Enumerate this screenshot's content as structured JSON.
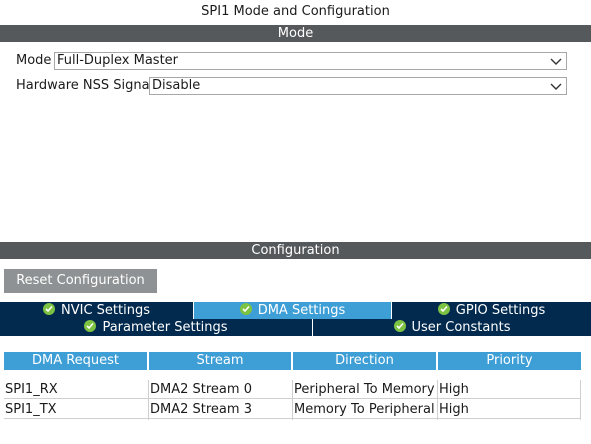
{
  "window": {
    "title": "SPI1 Mode and Configuration"
  },
  "mode_section": {
    "header": "Mode",
    "fields": [
      {
        "label": "Mode",
        "value": "Full-Duplex Master"
      },
      {
        "label": "Hardware NSS Signal",
        "value": "Disable"
      }
    ]
  },
  "config_section": {
    "header": "Configuration",
    "reset_label": "Reset Configuration",
    "tabs_row1": [
      {
        "label": "NVIC Settings",
        "active": false
      },
      {
        "label": "DMA Settings",
        "active": true
      },
      {
        "label": "GPIO Settings",
        "active": false
      }
    ],
    "tabs_row2": [
      {
        "label": "Parameter Settings",
        "active": false
      },
      {
        "label": "User Constants",
        "active": false
      }
    ]
  },
  "dma_table": {
    "columns": [
      "DMA Request",
      "Stream",
      "Direction",
      "Priority"
    ],
    "rows": [
      [
        "SPI1_RX",
        "DMA2 Stream 0",
        "Peripheral To Memory",
        "High"
      ],
      [
        "SPI1_TX",
        "DMA2 Stream 3",
        "Memory To Peripheral",
        "High"
      ]
    ]
  },
  "colors": {
    "section_bar": "#56595c",
    "tab_dark": "#022a4e",
    "tab_active": "#3e9ed6",
    "check_green": "#7cc243",
    "reset_button": "#8f9294"
  }
}
